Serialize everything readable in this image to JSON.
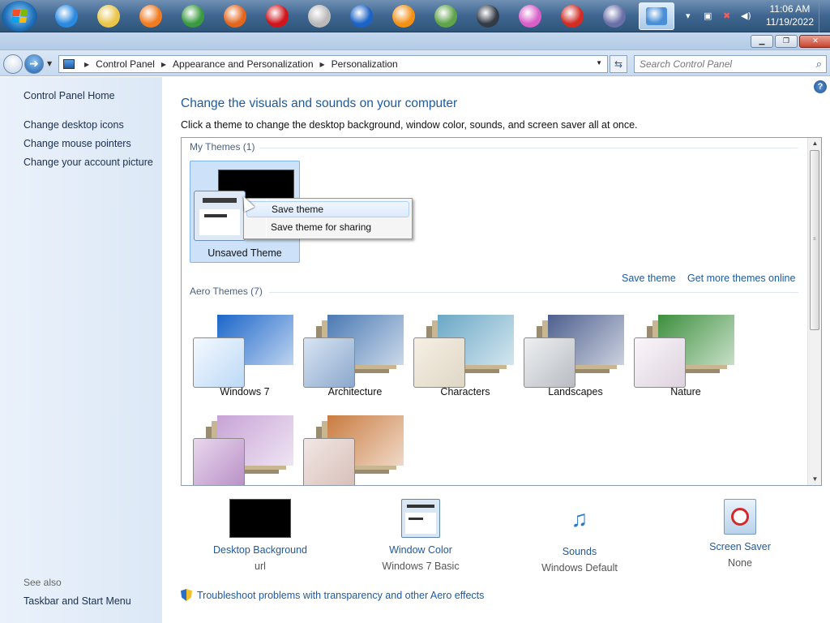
{
  "taskbar": {
    "apps": [
      {
        "name": "internet-explorer-icon",
        "color": "#2a8ae0"
      },
      {
        "name": "windows-explorer-icon",
        "color": "#e9c54a"
      },
      {
        "name": "media-player-icon",
        "color": "#f07b20"
      },
      {
        "name": "chrome-icon",
        "color": "#3b9a3f"
      },
      {
        "name": "firefox-icon",
        "color": "#e2661d"
      },
      {
        "name": "opera-icon",
        "color": "#d0151b"
      },
      {
        "name": "opera-next-icon",
        "color": "#b9b9b9"
      },
      {
        "name": "opera-blue-icon",
        "color": "#1b63c6"
      },
      {
        "name": "avast-icon",
        "color": "#f39117"
      },
      {
        "name": "globe-icon",
        "color": "#5fa34a"
      },
      {
        "name": "steam-icon",
        "color": "#333a46"
      },
      {
        "name": "itunes-icon",
        "color": "#d85fc8"
      },
      {
        "name": "ccleaner-icon",
        "color": "#d22c25"
      },
      {
        "name": "bittorrent-icon",
        "color": "#6b6fa8"
      },
      {
        "name": "control-panel-icon",
        "color": "#4a8fd6"
      }
    ],
    "clock": {
      "time": "11:06 AM",
      "date": "11/19/2022"
    }
  },
  "address": {
    "crumbs": [
      "Control Panel",
      "Appearance and Personalization",
      "Personalization"
    ],
    "search_placeholder": "Search Control Panel"
  },
  "sidebar": {
    "home": "Control Panel Home",
    "links": [
      "Change desktop icons",
      "Change mouse pointers",
      "Change your account picture"
    ],
    "see_also": "See also",
    "see_also_links": [
      "Taskbar and Start Menu"
    ]
  },
  "main": {
    "heading": "Change the visuals and sounds on your computer",
    "subheading": "Click a theme to change the desktop background, window color, sounds, and screen saver all at once.",
    "my_themes": "My Themes (1)",
    "unsaved_theme": "Unsaved Theme",
    "save_theme_link": "Save theme",
    "more_themes_link": "Get more themes online",
    "aero_themes": "Aero Themes (7)",
    "themes": [
      "Windows 7",
      "Architecture",
      "Characters",
      "Landscapes",
      "Nature"
    ],
    "theme_colors": {
      "windows7": "#1b66c9",
      "architecture": "#4a79b3",
      "characters": "#6aa8c6",
      "landscapes": "#4d5f8e",
      "nature": "#3d8f3e",
      "row2a": "#c7a3d6",
      "row2b": "#c97b3f"
    }
  },
  "context_menu": {
    "items": [
      "Save theme",
      "Save theme for sharing"
    ]
  },
  "bottom": [
    {
      "label": "Desktop Background",
      "value": "url"
    },
    {
      "label": "Window Color",
      "value": "Windows 7 Basic"
    },
    {
      "label": "Sounds",
      "value": "Windows Default"
    },
    {
      "label": "Screen Saver",
      "value": "None"
    }
  ],
  "troubleshoot": "Troubleshoot problems with transparency and other Aero effects"
}
